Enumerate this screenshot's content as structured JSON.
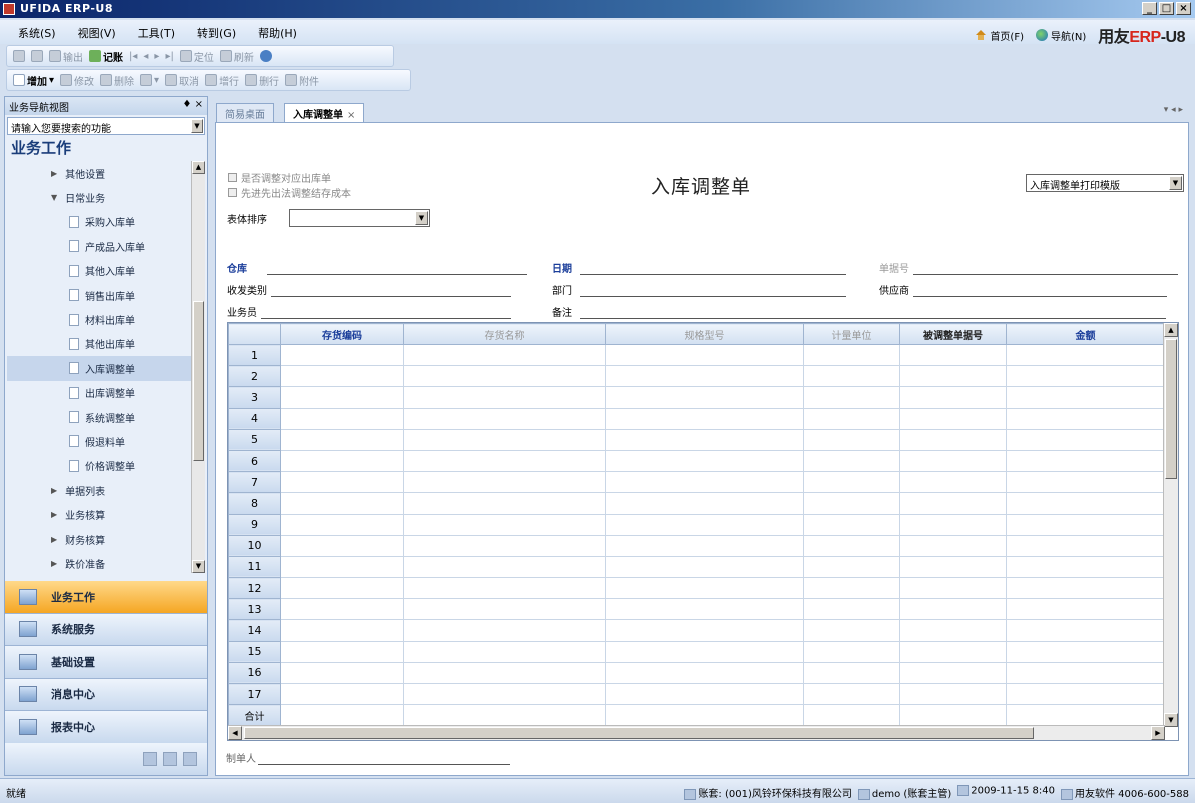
{
  "window": {
    "title": "UFIDA ERP-U8",
    "min": "_",
    "max": "□",
    "close": "×"
  },
  "menu": [
    "系统(S)",
    "视图(V)",
    "工具(T)",
    "转到(G)",
    "帮助(H)"
  ],
  "rightnav": {
    "home": "首页(F)",
    "nav": "导航(N)",
    "brand_prefix": "用友",
    "brand_erp": "ERP",
    "brand_suffix": "-U8"
  },
  "toolbar1": [
    "输出",
    "记账",
    "定位",
    "刷新"
  ],
  "toolbar2": [
    "增加",
    "修改",
    "删除",
    "取消",
    "增行",
    "删行",
    "附件"
  ],
  "left_panel": {
    "header": "业务导航视图",
    "pin": "♦ ×",
    "search_placeholder": "请输入您要搜索的功能",
    "section_title": "业务工作",
    "tree": [
      {
        "label": "其他设置",
        "level": "l1",
        "type": "arrow",
        "arrow": "▶"
      },
      {
        "label": "日常业务",
        "level": "l0",
        "type": "arrow",
        "arrow": "▼"
      },
      {
        "label": "采购入库单",
        "level": "l2",
        "type": "doc"
      },
      {
        "label": "产成品入库单",
        "level": "l2",
        "type": "doc"
      },
      {
        "label": "其他入库单",
        "level": "l2",
        "type": "doc"
      },
      {
        "label": "销售出库单",
        "level": "l2",
        "type": "doc"
      },
      {
        "label": "材料出库单",
        "level": "l2",
        "type": "doc"
      },
      {
        "label": "其他出库单",
        "level": "l2",
        "type": "doc"
      },
      {
        "label": "入库调整单",
        "level": "l2",
        "type": "doc",
        "selected": true
      },
      {
        "label": "出库调整单",
        "level": "l2",
        "type": "doc"
      },
      {
        "label": "系统调整单",
        "level": "l2",
        "type": "doc"
      },
      {
        "label": "假退料单",
        "level": "l2",
        "type": "doc"
      },
      {
        "label": "价格调整单",
        "level": "l2",
        "type": "doc"
      },
      {
        "label": "单据列表",
        "level": "l1",
        "type": "arrow",
        "arrow": "▶"
      },
      {
        "label": "业务核算",
        "level": "l0",
        "type": "arrow",
        "arrow": "▶"
      },
      {
        "label": "财务核算",
        "level": "l0",
        "type": "arrow",
        "arrow": "▶"
      },
      {
        "label": "跌价准备",
        "level": "l0",
        "type": "arrow",
        "arrow": "▶"
      }
    ],
    "outlook": [
      "业务工作",
      "系统服务",
      "基础设置",
      "消息中心",
      "报表中心"
    ]
  },
  "tabs": {
    "desktop": "简易桌面",
    "active": "入库调整单",
    "close": "×",
    "nav": "▾ ◂ ▸"
  },
  "form": {
    "check1": "是否调整对应出库单",
    "check2": "先进先出法调整结存成本",
    "title": "入库调整单",
    "print_template": "入库调整单打印模版",
    "sort_label": "表体排序",
    "fields": {
      "warehouse": "仓库",
      "date": "日期",
      "doc_no": "单据号",
      "rd_type": "收发类别",
      "dept": "部门",
      "supplier": "供应商",
      "salesman": "业务员",
      "remark": "备注"
    },
    "maker": "制单人"
  },
  "grid": {
    "columns": [
      "存货编码",
      "存货名称",
      "规格型号",
      "计量单位",
      "被调整单据号",
      "金额"
    ],
    "rows": [
      "1",
      "2",
      "3",
      "4",
      "5",
      "6",
      "7",
      "8",
      "9",
      "10",
      "11",
      "12",
      "13",
      "14",
      "15",
      "16",
      "17"
    ],
    "total_label": "合计"
  },
  "status": {
    "ready": "就绪",
    "account": "账套: (001)风铃环保科技有限公司",
    "user": "demo (账套主管)",
    "datetime": "2009-11-15 8:40",
    "vendor": "用友软件 4006-600-588"
  }
}
